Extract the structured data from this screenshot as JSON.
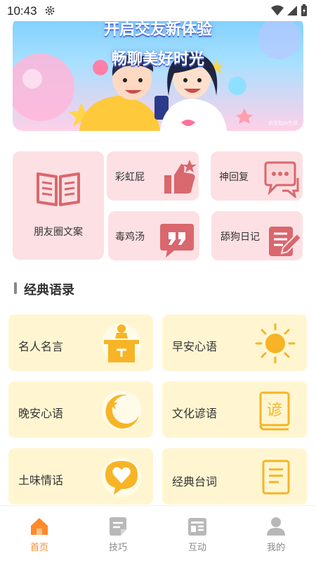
{
  "status_bar": {
    "time": "10:43"
  },
  "banner": {
    "title_line1": "开启交友新体验",
    "title_line2": "畅聊美好时光",
    "watermark": "由豆包AI生成"
  },
  "features": {
    "friend_circle": "朋友圈文案",
    "rainbow_fart": "彩虹屁",
    "god_reply": "神回复",
    "poison_soup": "毒鸡汤",
    "simp_diary": "舔狗日记"
  },
  "section": {
    "title": "经典语录"
  },
  "quote_cards": [
    {
      "label": "名人名言"
    },
    {
      "label": "早安心语"
    },
    {
      "label": "晚安心语"
    },
    {
      "label": "文化谚语"
    },
    {
      "label": "土味情话"
    },
    {
      "label": "经典台词"
    }
  ],
  "bottom_nav": {
    "items": [
      {
        "label": "首页",
        "active": true
      },
      {
        "label": "技巧"
      },
      {
        "label": "互动"
      },
      {
        "label": "我的"
      }
    ]
  },
  "colors": {
    "accent": "#ff8a2a",
    "feature_bg": "#fde0e3",
    "feature_icon": "#d9676e",
    "quote_bg": "#fff6d1",
    "quote_icon": "#f6b426"
  }
}
